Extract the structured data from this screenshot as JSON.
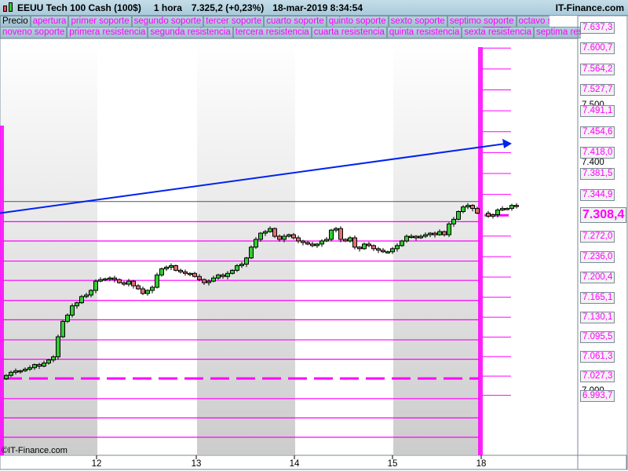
{
  "header": {
    "instrument": "EEUU Tech 100 Cash (100$)",
    "timeframe": "1 hora",
    "price": "7.325,2 (+0,23%)",
    "datetime": "18-mar-2019 8:34:54",
    "brand": "IT-Finance.com"
  },
  "legend_row1": [
    "Precio",
    "apertura",
    "primer soporte",
    "segundo soporte",
    "tercer soporte",
    "cuarto soporte",
    "quinto soporte",
    "sexto soporte",
    "septimo soporte",
    "octavo soporte"
  ],
  "legend_row2": [
    "noveno soporte",
    "primera resistencia",
    "segunda resistencia",
    "tercera resistencia",
    "cuarta resistencia",
    "quinta resistencia",
    "sexta resistencia",
    "septima resistencia"
  ],
  "copyright": "©IT-Finance.com",
  "colors": {
    "up": "#33cc33",
    "down": "#e07070",
    "level": "#ff00ff",
    "trend": "#0022ee"
  },
  "chart_data": {
    "type": "candlestick",
    "x_ticks": [
      "12",
      "13",
      "14",
      "15",
      "18"
    ],
    "y_labels": [
      "7.637,3",
      "7.600,7",
      "7.564,2",
      "7.527,7",
      "7.491,1",
      "7.454,6",
      "7.418,0",
      "7.381,5",
      "7.344,9",
      "7.272,0",
      "7.236,0",
      "7.200,4",
      "7.165,1",
      "7.130,1",
      "7.095,5",
      "7.061,3",
      "7.027,3",
      "6.993,7"
    ],
    "y_ticks_black": [
      "7.500",
      "7.400",
      "7.000"
    ],
    "current_price_label": "7.308,4",
    "closes": [
      7028.5,
      7033.9,
      7036.6,
      7036.6,
      7039.3,
      7042.0,
      7047.4,
      7044.7,
      7050.1,
      7055.5,
      7060.9,
      7096.0,
      7123.0,
      7133.9,
      7150.1,
      7155.5,
      7166.3,
      7169.0,
      7177.1,
      7193.3,
      7196.0,
      7197.3,
      7198.7,
      7196.0,
      7190.6,
      7187.9,
      7193.3,
      7185.2,
      7179.8,
      7171.7,
      7177.1,
      7182.5,
      7204.1,
      7214.9,
      7217.6,
      7220.3,
      7212.2,
      7209.5,
      7206.8,
      7206.8,
      7201.4,
      7196.0,
      7190.6,
      7193.3,
      7198.7,
      7204.1,
      7201.4,
      7206.8,
      7212.2,
      7220.3,
      7223.0,
      7233.8,
      7252.7,
      7266.3,
      7277.1,
      7279.8,
      7285.2,
      7271.7,
      7266.3,
      7271.7,
      7274.4,
      7269.0,
      7263.5,
      7260.8,
      7258.1,
      7255.4,
      7258.1,
      7263.5,
      7266.3,
      7282.5,
      7285.2,
      7266.3,
      7263.5,
      7269.0,
      7252.7,
      7250.0,
      7258.1,
      7255.4,
      7250.0,
      7247.3,
      7244.6,
      7244.6,
      7250.0,
      7255.4,
      7263.5,
      7271.7,
      7271.7,
      7269.0,
      7271.7,
      7274.4,
      7277.1,
      7274.4,
      7279.8,
      7274.4,
      7293.3,
      7301.4,
      7314.9,
      7323.0,
      7325.7,
      7320.3,
      7312.2,
      7306.8,
      7309.5,
      7317.6,
      7320.3,
      7320.3,
      7325.7,
      7325.2
    ],
    "levels": [
      7297.3,
      7263.5,
      7228.4,
      7194.6,
      7159.5,
      7125.7,
      7090.6,
      7056.8,
      7023.1,
      6987.9,
      6954.2,
      6920.4
    ],
    "dashed_level": 7023.1,
    "price_line": 7332.4,
    "trendline": {
      "start": 7312.2,
      "end": 7433.8
    }
  }
}
